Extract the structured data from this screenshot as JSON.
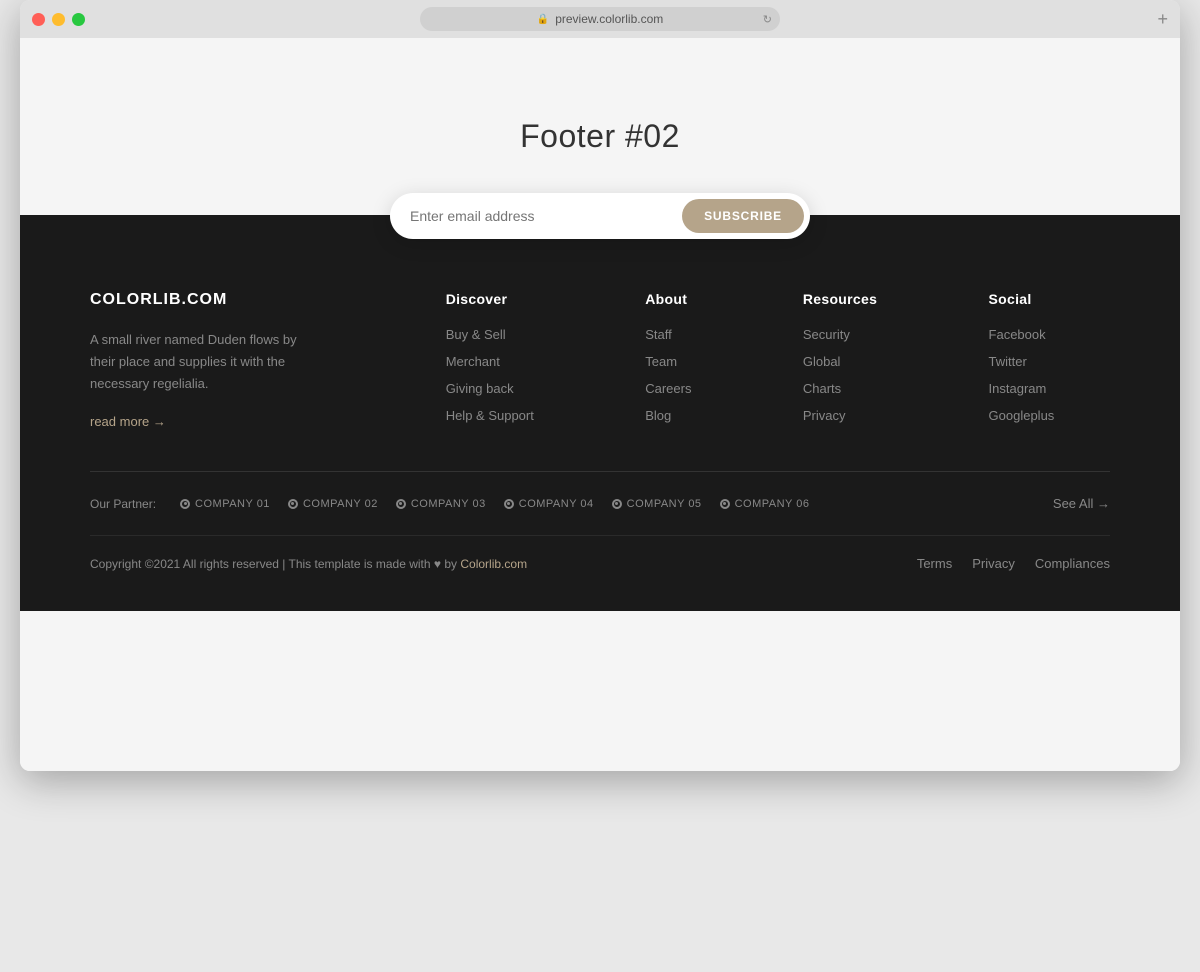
{
  "browser": {
    "url": "preview.colorlib.com",
    "new_tab_icon": "+"
  },
  "hero": {
    "title": "Footer #02"
  },
  "subscribe": {
    "input_placeholder": "Enter email address",
    "button_label": "SUBSCRIBE"
  },
  "footer": {
    "brand": {
      "name": "COLORLIB.COM",
      "description": "A small river named Duden flows by their place and supplies it with the necessary regelialia.",
      "read_more": "read more →"
    },
    "columns": [
      {
        "title": "Discover",
        "links": [
          "Buy & Sell",
          "Merchant",
          "Giving back",
          "Help & Support"
        ]
      },
      {
        "title": "About",
        "links": [
          "Staff",
          "Team",
          "Careers",
          "Blog"
        ]
      },
      {
        "title": "Resources",
        "links": [
          "Security",
          "Global",
          "Charts",
          "Privacy"
        ]
      },
      {
        "title": "Social",
        "links": [
          "Facebook",
          "Twitter",
          "Instagram",
          "Googleplus"
        ]
      }
    ],
    "partners": {
      "label": "Our Partner:",
      "companies": [
        "COMPANY 01",
        "COMPANY 02",
        "COMPANY 03",
        "COMPANY 04",
        "COMPANY 05",
        "COMPANY 06"
      ],
      "see_all": "See All →"
    },
    "copyright": "Copyright ©2021 All rights reserved | This template is made with ♥ by",
    "copyright_link_text": "Colorlib.com",
    "legal_links": [
      "Terms",
      "Privacy",
      "Compliances"
    ]
  }
}
